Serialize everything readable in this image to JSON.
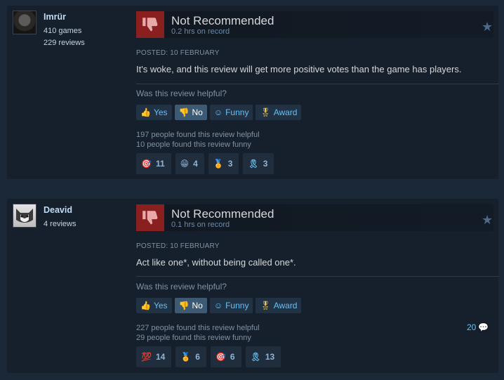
{
  "ui": {
    "helpful_question": "Was this review helpful?",
    "btn_yes": "Yes",
    "btn_no": "No",
    "btn_funny": "Funny",
    "btn_award": "Award"
  },
  "reviews": [
    {
      "author": "Imrür",
      "games": "410 games",
      "reviews": "229 reviews",
      "recommendation": "Not Recommended",
      "hours": "0.2 hrs on record",
      "posted": "POSTED: 10 FEBRUARY",
      "text": "It's woke, and this review will get more positive votes than the game has players.",
      "helpful": "197 people found this review helpful",
      "funny": "10 people found this review funny",
      "awards": [
        {
          "icon": "target-icon",
          "count": "11"
        },
        {
          "icon": "grin-icon",
          "count": "4"
        },
        {
          "icon": "medal-icon",
          "count": "3"
        },
        {
          "icon": "ribbon-icon",
          "count": "3"
        }
      ]
    },
    {
      "author": "Deavid",
      "reviews": "4 reviews",
      "recommendation": "Not Recommended",
      "hours": "0.1 hrs on record",
      "posted": "POSTED: 10 FEBRUARY",
      "text": "Act like one*, without being called one*.",
      "helpful": "227 people found this review helpful",
      "funny": "29 people found this review funny",
      "comments": "20",
      "awards": [
        {
          "icon": "hundred-icon",
          "count": "14"
        },
        {
          "icon": "medal-icon",
          "count": "6"
        },
        {
          "icon": "target-icon",
          "count": "6"
        },
        {
          "icon": "ribbon-icon",
          "count": "13"
        }
      ]
    }
  ],
  "colors": {
    "background": "#1b2838",
    "card": "#16202d",
    "thumb_down": "#8a1f1f",
    "link_blue": "#66c0f4",
    "active_button": "#3d5a74"
  }
}
